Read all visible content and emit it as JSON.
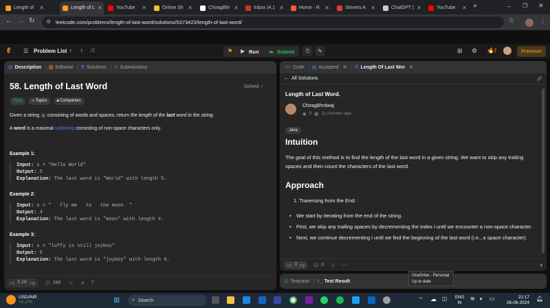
{
  "browser": {
    "tabs": [
      {
        "label": "Length of",
        "color": "#ffa116",
        "active": false
      },
      {
        "label": "Length of L",
        "color": "#ffa116",
        "active": true
      },
      {
        "label": "YouTube",
        "color": "#ff0000",
        "active": false
      },
      {
        "label": "Online Sh",
        "color": "#f5c518",
        "active": false
      },
      {
        "label": "ChiragBhr",
        "color": "#ffffff",
        "active": false
      },
      {
        "label": "Inbox (4,1",
        "color": "#d93025",
        "active": false
      },
      {
        "label": "Home - R",
        "color": "#ff5733",
        "active": false
      },
      {
        "label": "Strivers A",
        "color": "#e53935",
        "active": false
      },
      {
        "label": "ChatGPT |",
        "color": "#cccccc",
        "active": false
      },
      {
        "label": "YouTube",
        "color": "#ff0000",
        "active": false
      }
    ],
    "url": "leetcode.com/problems/length-of-last-word/solutions/5373423/length-of-last-word/"
  },
  "lc_nav": {
    "problem_list": "Problem List",
    "run": "Run",
    "submit": "Submit",
    "streak": "7",
    "premium": "Premium"
  },
  "left": {
    "tabs": [
      "Description",
      "Editorial",
      "Solutions",
      "Submissions"
    ],
    "title": "58. Length of Last Word",
    "solved": "Solved",
    "tags": [
      "Easy",
      "Topics",
      "Companies"
    ],
    "desc1_a": "Given a string ",
    "desc1_code": "s",
    "desc1_b": " consisting of words and spaces, return ",
    "desc1_c": "the length of the ",
    "desc1_d": "last",
    "desc1_e": " word in the string.",
    "desc2_a": "A ",
    "desc2_b": "word",
    "desc2_c": " is a maximal ",
    "desc2_link": "substring",
    "desc2_d": " consisting of non-space characters only.",
    "examples": [
      {
        "title": "Example 1:",
        "input": "s = \"Hello World\"",
        "output": "5",
        "explanation": "The last word is \"World\" with length 5."
      },
      {
        "title": "Example 2:",
        "input": "s = \"   fly me   to   the moon  \"",
        "output": "4",
        "explanation": "The last word is \"moon\" with length 4."
      },
      {
        "title": "Example 3:",
        "input": "s = \"luffy is still joyboy\"",
        "output": "6",
        "explanation": "The last word is \"joyboy\" with length 6."
      }
    ],
    "labels": {
      "input": "Input:",
      "output": "Output:",
      "explanation": "Explanation:"
    },
    "likes": "5.2K",
    "comments": "286"
  },
  "right": {
    "tabs": [
      "Code",
      "Accepted",
      "Length Of Last Wor"
    ],
    "back": "All Solutions",
    "sol_title": "Length of Last Word.",
    "author": "ChiragBhrdwaj",
    "views": "0",
    "comments": "0",
    "time": "11 minutes ago",
    "lang": "Java",
    "h_intuition": "Intuition",
    "intuition": "The goal of this method is to find the length of the last word in a given string. We want to skip any trailing spaces and then count the characters of the last word.",
    "h_approach": "Approach",
    "step1": "1. Traversing from the End:",
    "bullets": [
      "We start by iterating from the end of the string.",
      "First, we skip any trailing spaces by decrementing the index i until we encounter a non-space character.",
      "Next, we continue decrementing i until we find the beginning of the last word (i.e., a space character)."
    ],
    "votes_up": "0",
    "votes_comments": "0",
    "testcase": "Testcase",
    "test_result": "Test Result"
  },
  "tooltip": {
    "line1": "OneDrive - Personal",
    "line2": "Up to date"
  },
  "taskbar": {
    "ticker": "USD/INR",
    "change": "+0.17%",
    "search": "Search",
    "lang1": "ENG",
    "lang2": "IN",
    "time": "22:17",
    "date": "26-06-2024"
  },
  "colors": {
    "accent": "#ffa116",
    "green": "#2cbb5d",
    "link": "#3b82f6",
    "easy": "#00b8a3"
  }
}
